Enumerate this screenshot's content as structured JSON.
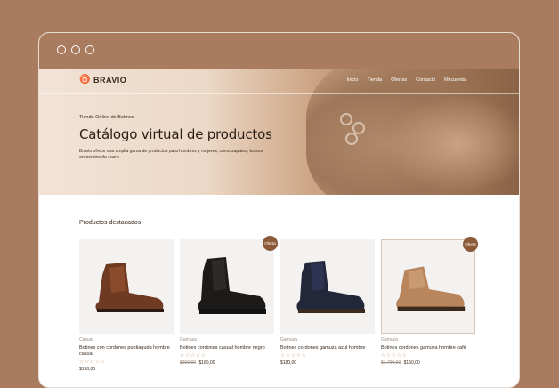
{
  "site": {
    "logo": "BRAVIO",
    "menu": [
      "Inicio",
      "Tienda",
      "Ofertas",
      "Contacto",
      "Mi cuenta"
    ]
  },
  "hero": {
    "subtitle": "Tienda Online de Botines",
    "title": "Catálogo virtual de productos",
    "description": "Bravio ofrece una amplia gama de productos para hombres y mujeres, como zapatos, bolsos, accesorios de cuero."
  },
  "section": {
    "title": "Productos destacados"
  },
  "products": [
    {
      "category": "Casual",
      "name": "Botines con cordones puntiaguda hombre casual",
      "price": "$190,00",
      "old_price": "",
      "badge": ""
    },
    {
      "category": "Gamuza",
      "name": "Botines cordones casual hombre negro",
      "price": "$180,00",
      "old_price": "$200,00",
      "badge": "Oferta"
    },
    {
      "category": "Gamuza",
      "name": "Botines cordones gamuza azul hombre",
      "price": "$180,00",
      "old_price": "",
      "badge": ""
    },
    {
      "category": "Gamuza",
      "name": "Botines cordones gamuza hombre café",
      "price": "$150,00",
      "old_price": "$1.790,00",
      "badge": "Oferta"
    }
  ],
  "colors": {
    "accent": "#8b5a38",
    "background": "#a97c5f"
  },
  "icons": {
    "logo": "bull-icon",
    "rating": "star-icon"
  }
}
